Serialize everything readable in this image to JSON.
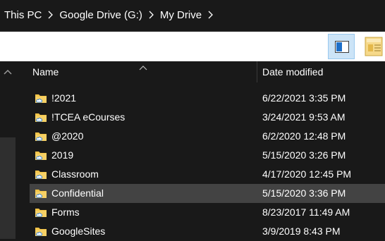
{
  "breadcrumb": {
    "items": [
      "This PC",
      "Google Drive (G:)",
      "My Drive"
    ]
  },
  "ribbon": {
    "preview_pane_icon": "preview-pane-icon",
    "details_icon": "details-pane-icon"
  },
  "columns": {
    "name": "Name",
    "date_modified": "Date modified"
  },
  "files": [
    {
      "name": "!2021",
      "date": "6/22/2021 3:35 PM",
      "selected": false
    },
    {
      "name": "!TCEA eCourses",
      "date": "3/24/2021 9:53 AM",
      "selected": false
    },
    {
      "name": "@2020",
      "date": "6/2/2020 12:48 PM",
      "selected": false
    },
    {
      "name": "2019",
      "date": "5/15/2020 3:26 PM",
      "selected": false
    },
    {
      "name": "Classroom",
      "date": "4/17/2020 12:45 PM",
      "selected": false
    },
    {
      "name": "Confidential",
      "date": "5/15/2020 3:36 PM",
      "selected": true
    },
    {
      "name": "Forms",
      "date": "8/23/2017 11:49 AM",
      "selected": false
    },
    {
      "name": "GoogleSites",
      "date": "3/9/2019 8:43 PM",
      "selected": false
    }
  ],
  "colors": {
    "background": "#191919",
    "selected_row": "#434343",
    "folder_yellow": "#f3c448",
    "cloud_blue": "#2f7fd6"
  }
}
